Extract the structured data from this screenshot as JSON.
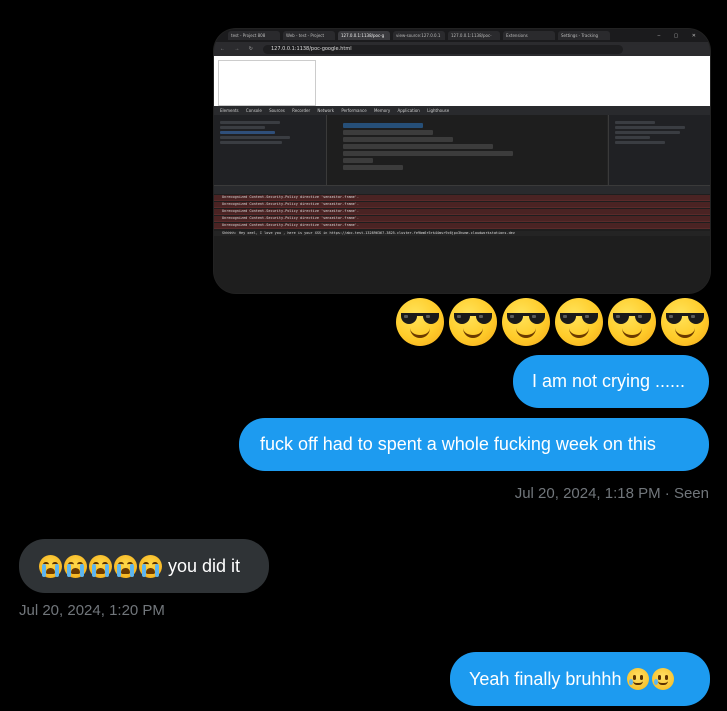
{
  "screenshot": {
    "tabs": [
      "test - Project 808",
      "Web - test - Project",
      "127.0.0.1:1138/poc-g",
      "view-source:127.0.0.1",
      "127.0.0.1:1138/poc-",
      "Extensions",
      "Settings - Tracking"
    ],
    "url": "127.0.0.1:1138/poc-google.html",
    "devtools_tabs": "Elements Console Sources Recorder Network Performance Memory Application Lighthouse",
    "console_lines": [
      "Unrecognized Content-Security-Policy directive 'senseitor-frame'.",
      "Unrecognized Content-Security-Policy directive 'senseitor-frame'.",
      "Unrecognized Content-Security-Policy directive 'senseitor-frame'.",
      "Unrecognized Content-Security-Policy directive 'senseitor-frame'.",
      "Unrecognized Content-Security-Policy directive 'senseitor-frame'."
    ],
    "message_line": "Shhhhh: Hey xeel, I love you , here is your XSS in https://abc-test-132896367-3825.cluster-fe9bm6r5rk44msr9c6jpx3hume.cloudworkstations.dev"
  },
  "messages": [
    {
      "text": "I am not crying ......",
      "direction": "sent"
    },
    {
      "text": "fuck off had to spent a whole fucking week on this",
      "direction": "sent"
    },
    {
      "text": "you did it",
      "direction": "received"
    },
    {
      "text": "Yeah finally bruhhh",
      "direction": "sent"
    }
  ],
  "timestamps": {
    "sent_seen": "Jul 20, 2024, 1:18 PM · Seen",
    "received": "Jul 20, 2024, 1:20 PM"
  },
  "emojis": {
    "cool_row": "smiling-face-with-sunglasses x6",
    "you_did_it_prefix": "loudly-crying-face x5",
    "finally_suffix": "face-holding-back-tears x2"
  },
  "colors": {
    "sent_bubble": "#1d9bf0",
    "received_bubble": "#2f3336",
    "meta_text": "#71767b",
    "background": "#000000"
  }
}
